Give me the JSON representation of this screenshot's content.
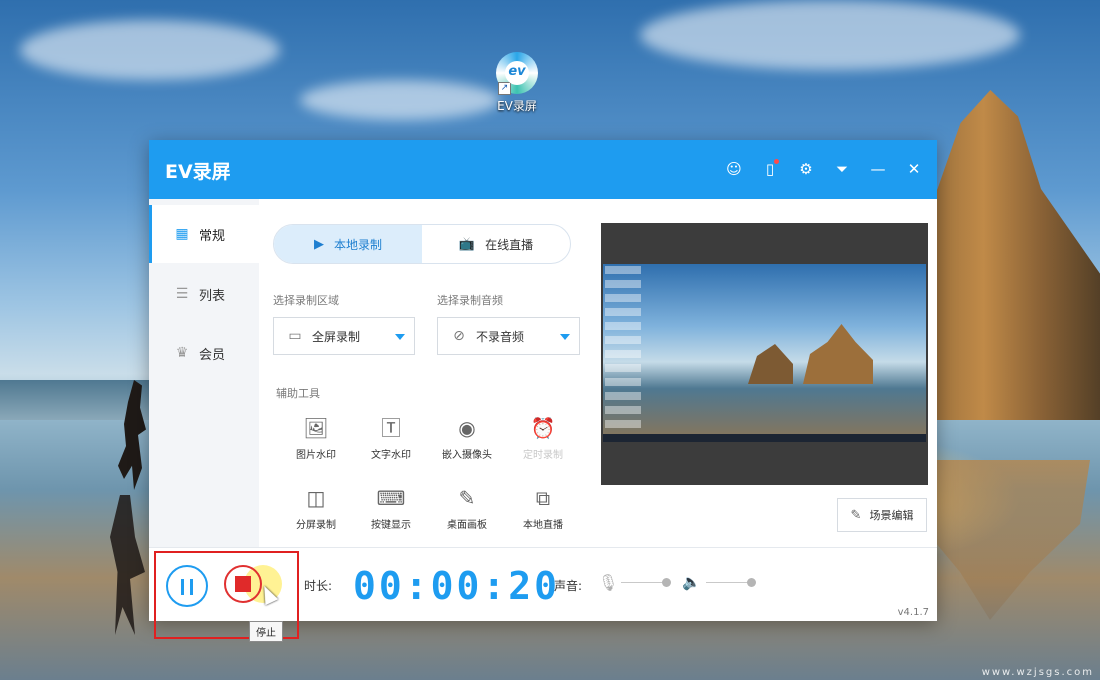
{
  "desktop": {
    "icon_label": "EV录屏",
    "watermark": "www.wzjsgs.com"
  },
  "app": {
    "title": "EV录屏",
    "titlebar_icons": [
      "user-icon",
      "notification-icon",
      "settings-icon",
      "dropdown-icon",
      "minimize-icon",
      "close-icon"
    ],
    "accent_color": "#1e9cf0",
    "sidebar": {
      "items": [
        {
          "label": "常规",
          "icon": "grid-icon",
          "active": true
        },
        {
          "label": "列表",
          "icon": "list-icon",
          "active": false
        },
        {
          "label": "会员",
          "icon": "crown-icon",
          "active": false
        }
      ]
    },
    "tabs": [
      {
        "label": "本地录制",
        "active": true
      },
      {
        "label": "在线直播",
        "active": false
      }
    ],
    "region": {
      "label": "选择录制区域",
      "value": "全屏录制"
    },
    "audio": {
      "label": "选择录制音频",
      "value": "不录音频"
    },
    "tools": {
      "heading": "辅助工具",
      "items": [
        {
          "label": "图片水印",
          "icon": "image-icon",
          "enabled": true
        },
        {
          "label": "文字水印",
          "icon": "text-icon",
          "enabled": true
        },
        {
          "label": "嵌入摄像头",
          "icon": "webcam-icon",
          "enabled": true
        },
        {
          "label": "定时录制",
          "icon": "alarm-icon",
          "enabled": false
        },
        {
          "label": "分屏录制",
          "icon": "split-screen-icon",
          "enabled": true
        },
        {
          "label": "按键显示",
          "icon": "keyboard-icon",
          "enabled": true
        },
        {
          "label": "桌面画板",
          "icon": "easel-icon",
          "enabled": true
        },
        {
          "label": "本地直播",
          "icon": "play-screen-icon",
          "enabled": true
        }
      ]
    },
    "scene_edit_label": "场景编辑",
    "bottom": {
      "duration_label": "时长:",
      "timer": "00:00:20",
      "volume_label": "声音:",
      "stop_tooltip": "停止",
      "version": "v4.1.7"
    }
  }
}
